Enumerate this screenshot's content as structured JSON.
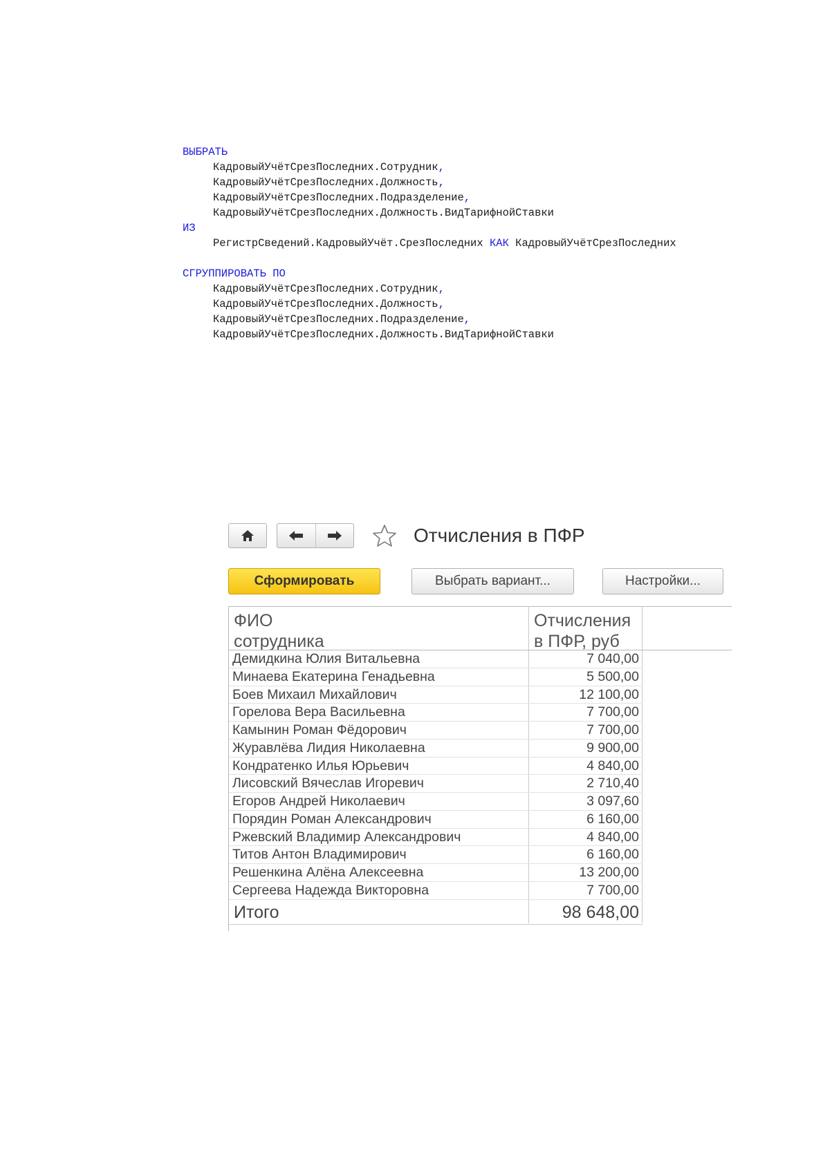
{
  "query": {
    "lines": [
      {
        "kw": "ВЫБРАТЬ",
        "text": ""
      },
      {
        "indent": true,
        "text": "КадровыйУчётСрезПоследних.Сотрудник",
        "punct": ","
      },
      {
        "indent": true,
        "text": "КадровыйУчётСрезПоследних.Должность",
        "punct": ","
      },
      {
        "indent": true,
        "text": "КадровыйУчётСрезПоследних.Подразделение",
        "punct": ","
      },
      {
        "indent": true,
        "text": "КадровыйУчётСрезПоследних.Должность.ВидТарифнойСтавки",
        "punct": ""
      },
      {
        "kw": "ИЗ",
        "text": ""
      },
      {
        "indent": true,
        "text": "РегистрСведений.КадровыйУчёт.СрезПоследних ",
        "kw2": "КАК",
        "text2": " КадровыйУчётСрезПоследних"
      },
      {
        "blank": true
      },
      {
        "kw": "СГРУППИРОВАТЬ ПО",
        "text": ""
      },
      {
        "indent": true,
        "text": "КадровыйУчётСрезПоследних.Сотрудник",
        "punct": ","
      },
      {
        "indent": true,
        "text": "КадровыйУчётСрезПоследних.Должность",
        "punct": ","
      },
      {
        "indent": true,
        "text": "КадровыйУчётСрезПоследних.Подразделение",
        "punct": ","
      },
      {
        "indent": true,
        "text": "КадровыйУчётСрезПоследних.Должность.ВидТарифнойСтавки",
        "punct": ""
      }
    ]
  },
  "report": {
    "title": "Отчисления в ПФР",
    "icons": {
      "home": "home-icon",
      "back": "arrow-left-icon",
      "forward": "arrow-right-icon",
      "favorite": "star-icon"
    },
    "buttons": {
      "generate": "Сформировать",
      "choose_variant": "Выбрать вариант...",
      "settings": "Настройки..."
    },
    "table": {
      "col_name": "ФИО сотрудника",
      "col_amount_line1": "Отчисления",
      "col_amount_line2": "в ПФР, руб",
      "rows": [
        {
          "name": "Демидкина Юлия Витальевна",
          "amount": "7 040,00"
        },
        {
          "name": "Минаева Екатерина Генадьевна",
          "amount": "5 500,00"
        },
        {
          "name": "Боев Михаил Михайлович",
          "amount": "12 100,00"
        },
        {
          "name": "Горелова Вера Васильевна",
          "amount": "7 700,00"
        },
        {
          "name": "Камынин Роман Фёдорович",
          "amount": "7 700,00"
        },
        {
          "name": "Журавлёва Лидия Николаевна",
          "amount": "9 900,00"
        },
        {
          "name": "Кондратенко Илья Юрьевич",
          "amount": "4 840,00"
        },
        {
          "name": "Лисовский Вячеслав Игоревич",
          "amount": "2 710,40"
        },
        {
          "name": "Егоров Андрей Николаевич",
          "amount": "3 097,60"
        },
        {
          "name": "Порядин Роман Александрович",
          "amount": "6 160,00"
        },
        {
          "name": "Ржевский Владимир Александрович",
          "amount": "4 840,00"
        },
        {
          "name": "Титов Антон Владимирович",
          "amount": "6 160,00"
        },
        {
          "name": "Решенкина Алёна Алексеевна",
          "amount": "13 200,00"
        },
        {
          "name": "Сергеева Надежда Викторовна",
          "amount": "7 700,00"
        }
      ],
      "total_label": "Итого",
      "total_amount": "98 648,00"
    }
  }
}
